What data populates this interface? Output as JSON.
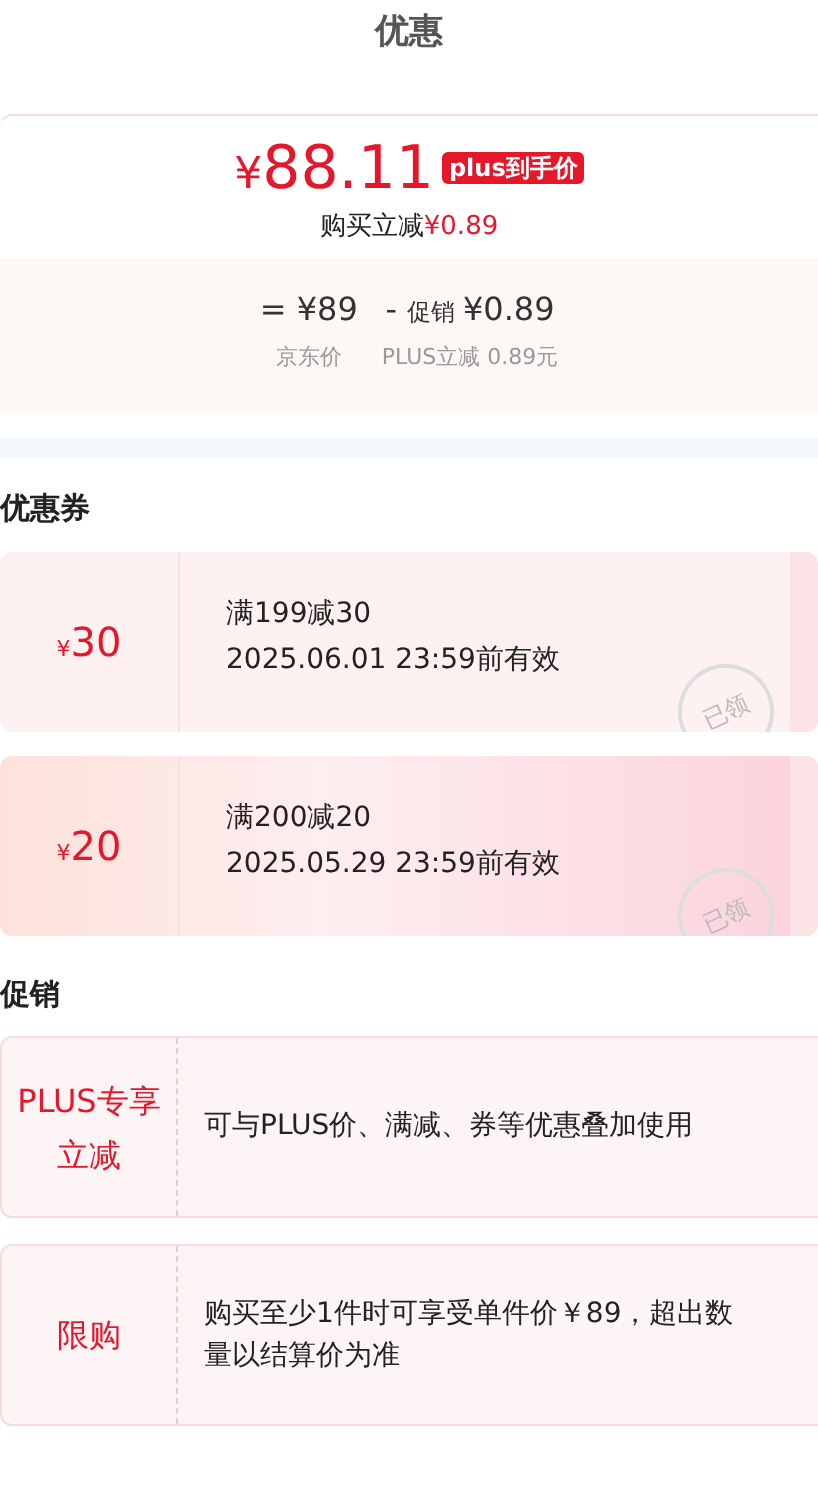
{
  "title": "优惠",
  "price_card": {
    "currency": "¥",
    "amount": "88.11",
    "tag": "plus到手价",
    "saving_label": "购买立减",
    "saving_value": "¥0.89",
    "breakdown": [
      {
        "op": "=",
        "value": "¥89",
        "caption": "京东价"
      },
      {
        "op": "-",
        "label": "促销",
        "value": "¥0.89",
        "caption": "PLUS立减 0.89元"
      }
    ]
  },
  "coupon_section": {
    "heading": "优惠券",
    "coupons": [
      {
        "kind": "plain",
        "currency": "¥",
        "amount": "30",
        "rule": "满199减30",
        "validity": "2025.06.01 23:59前有效",
        "stamp": "已领"
      },
      {
        "kind": "festive",
        "currency": "¥",
        "amount": "20",
        "rule": "满200减20",
        "validity": "2025.05.29 23:59前有效",
        "stamp": "已领"
      }
    ]
  },
  "promo_section": {
    "heading": "促销",
    "promos": [
      {
        "label": "PLUS专享立减",
        "text": "可与PLUS价、满减、券等优惠叠加使用"
      },
      {
        "label": "限购",
        "text": "购买至少1件时可享受单件价￥89，超出数量以结算价为准"
      }
    ]
  }
}
